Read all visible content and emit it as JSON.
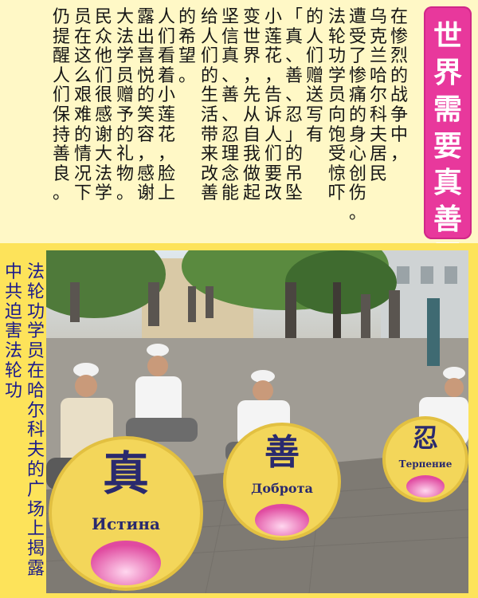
{
  "title": {
    "text": "世界需要真善忍",
    "color": "#e8389c"
  },
  "article": {
    "columns": [
      "在惨烈的战争中，",
      "乌克兰哈尔科夫居民",
      "遭受了惨痛的身心创伤。",
      "法轮功学员向饱受惊吓",
      "的人们赠送写有",
      "「真、善、忍」的吊坠",
      "小莲花，告诉人们要改",
      "变世界，先从自我做起",
      "坚信真、善、忍理念能",
      "给人们的生活带来改善",
      "的希望。",
      "人们看着小莲花，脸上",
      "露出喜悦的笑容，感谢",
      "大法学员赠予的礼物。",
      "民众他们很感谢大法学",
      "员在这么艰难的情况下",
      "仍提醒人们保持善良。"
    ]
  },
  "caption": {
    "left_column": "中共迫害法轮功",
    "right_column": "法轮功学员在哈尔科夫的广场上揭露"
  },
  "photo": {
    "boards": [
      {
        "char": "真",
        "word": "Истина"
      },
      {
        "char": "善",
        "word": "Доброта"
      },
      {
        "char": "忍",
        "word": "Терпение"
      }
    ]
  }
}
